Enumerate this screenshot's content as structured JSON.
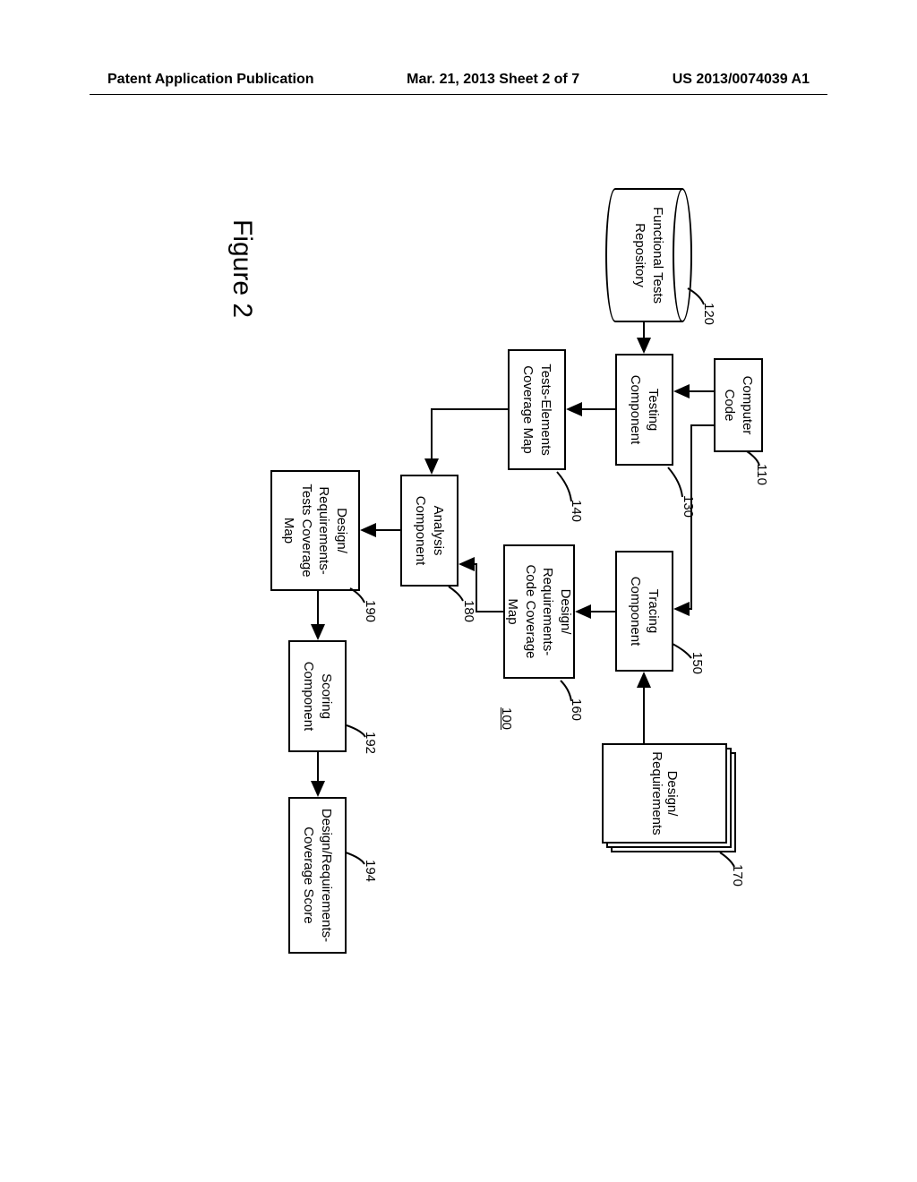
{
  "header": {
    "left": "Patent Application Publication",
    "center": "Mar. 21, 2013  Sheet 2 of 7",
    "right": "US 2013/0074039 A1"
  },
  "refs": {
    "r110": "110",
    "r120": "120",
    "r130": "130",
    "r140": "140",
    "r150": "150",
    "r160": "160",
    "r170": "170",
    "r180": "180",
    "r190": "190",
    "r192": "192",
    "r194": "194",
    "r100": "100"
  },
  "nodes": {
    "computer_code": "Computer\nCode",
    "functional_tests": "Functional\nTests Repository",
    "testing_component": "Testing\nComponent",
    "tracing_component": "Tracing\nComponent",
    "design_requirements": "Design/\nRequirements",
    "tests_elements_map": "Tests-Elements\nCoverage Map",
    "design_req_code_map": "Design/\nRequirements-Code\nCoverage Map",
    "analysis_component": "Analysis\nComponent",
    "design_req_tests_map": "Design/\nRequirements-\nTests\nCoverage Map",
    "scoring_component": "Scoring\nComponent",
    "design_req_score": "Design/Requirements-\nCoverage Score"
  },
  "figure_caption": "Figure 2"
}
